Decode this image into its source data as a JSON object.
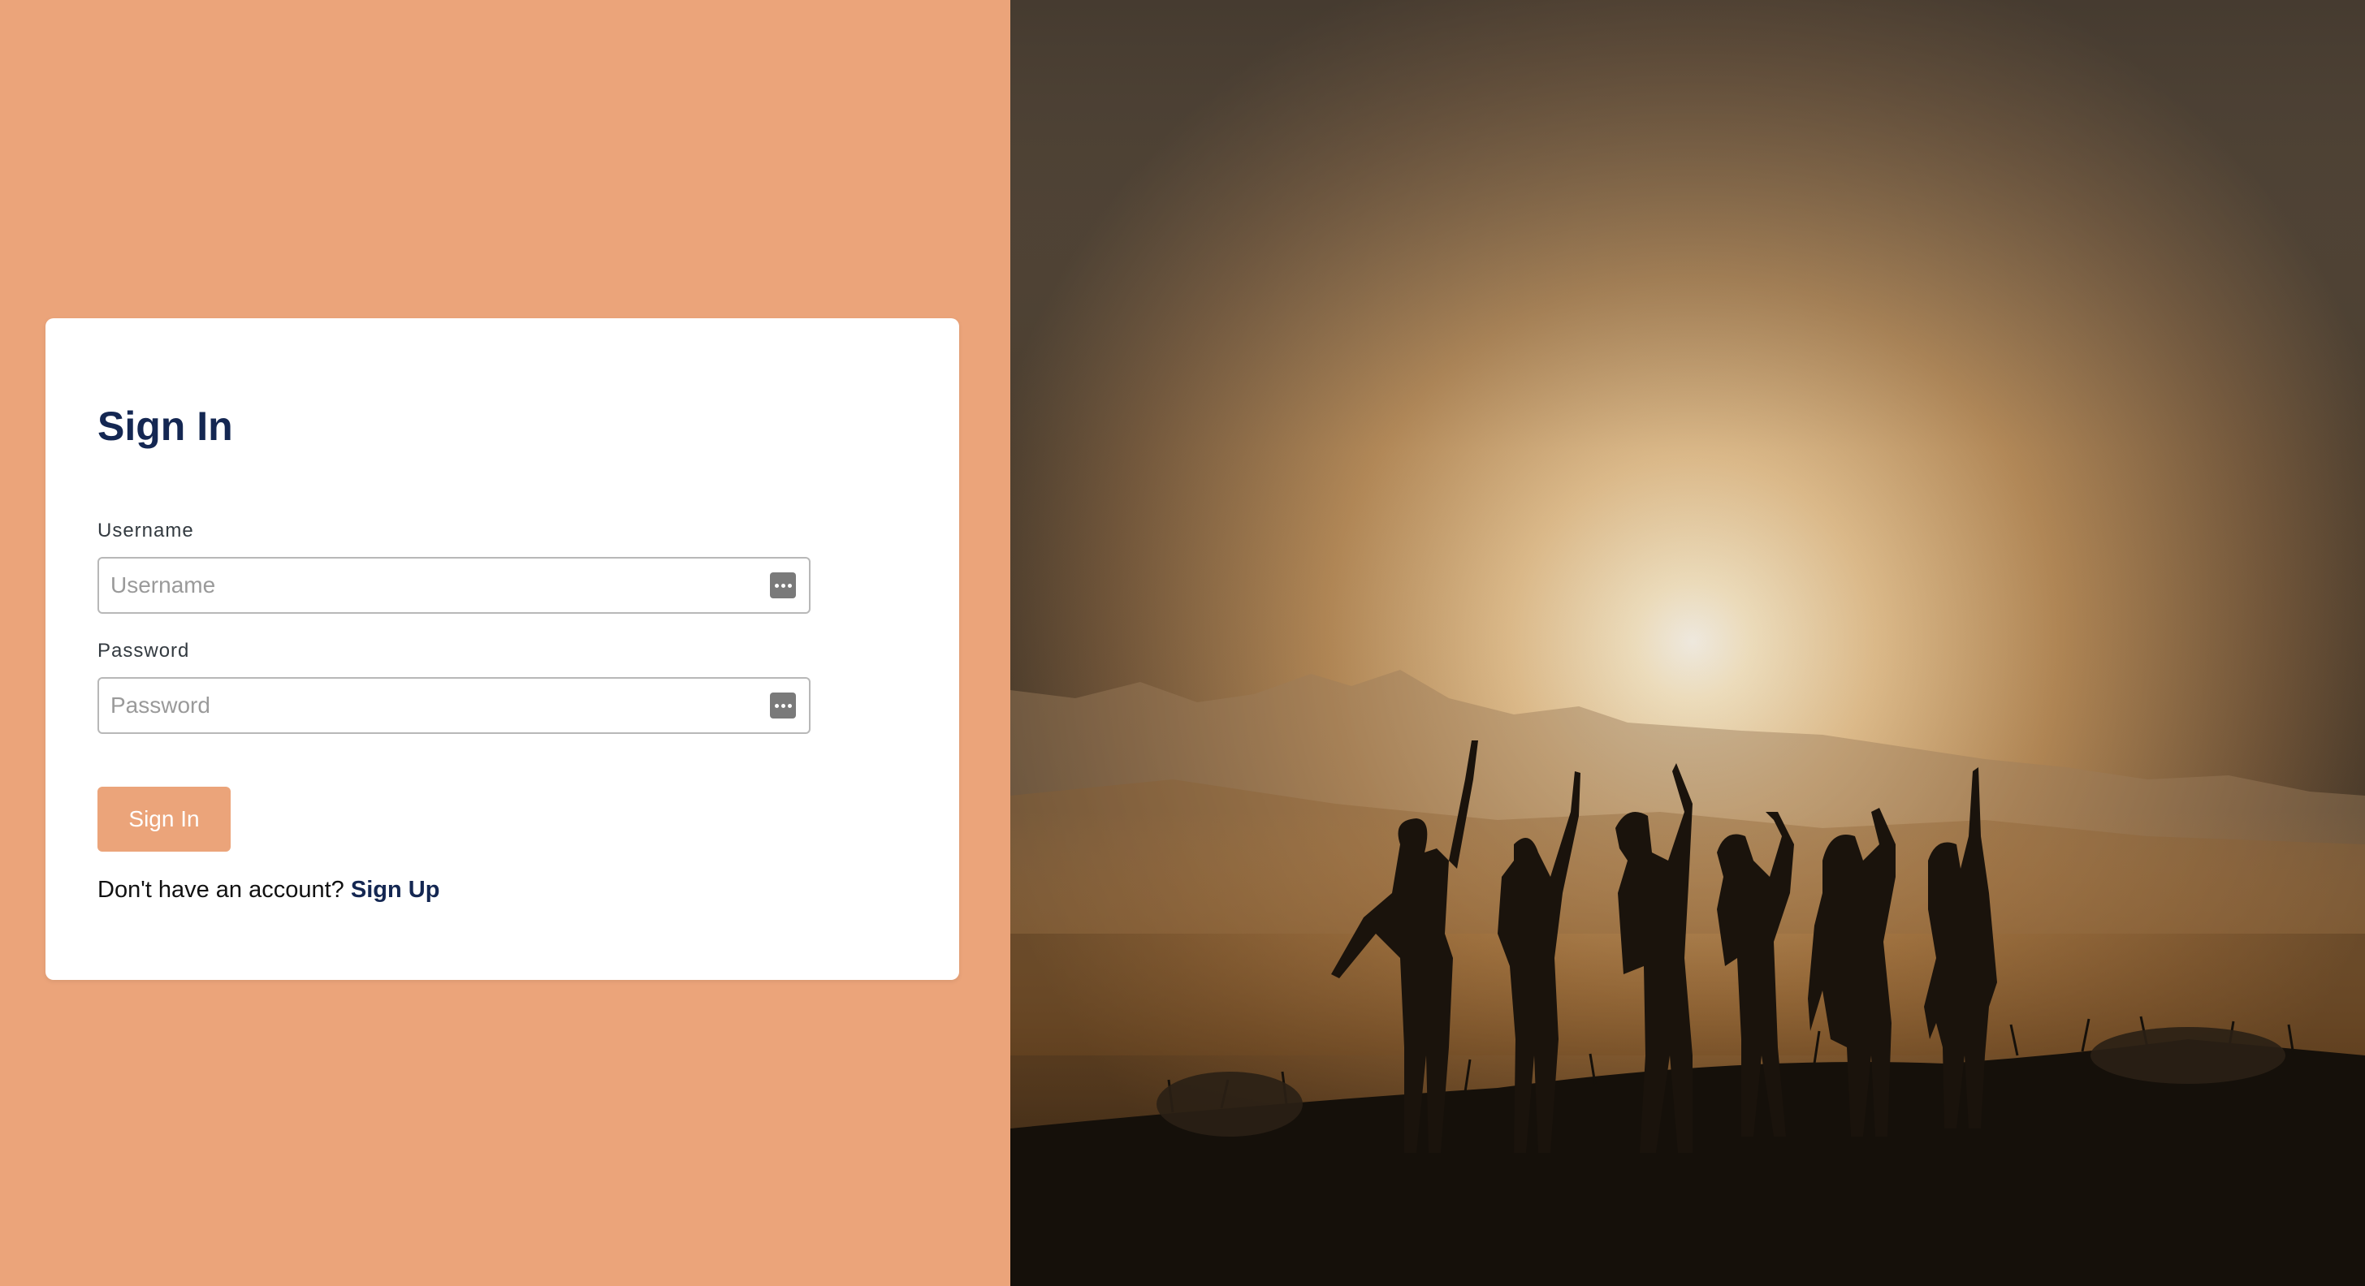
{
  "signin": {
    "title": "Sign In",
    "username_label": "Username",
    "username_placeholder": "Username",
    "username_value": "",
    "password_label": "Password",
    "password_placeholder": "Password",
    "password_value": "",
    "submit_label": "Sign In",
    "no_account_text": "Don't have an account?",
    "signup_link": "Sign Up"
  },
  "colors": {
    "accent": "#eba47a",
    "title": "#142752",
    "card_bg": "#ffffff"
  },
  "icons": {
    "field_icon": "password-manager-dots-icon"
  },
  "hero_image": {
    "subject": "silhouettes of people waving at sunset on a hill"
  }
}
